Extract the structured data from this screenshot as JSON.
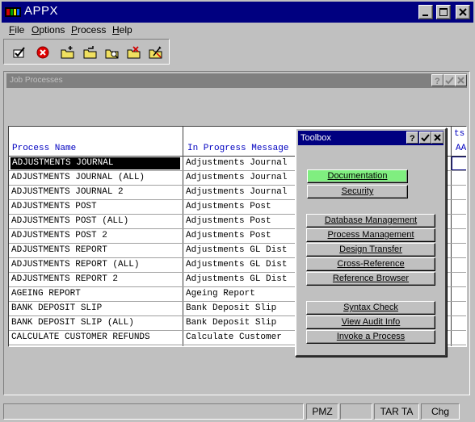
{
  "window": {
    "title": "APPX"
  },
  "menu": [
    {
      "pre": "",
      "u": "F",
      "post": "ile"
    },
    {
      "pre": "",
      "u": "O",
      "post": "ptions"
    },
    {
      "pre": "",
      "u": "P",
      "post": "rocess"
    },
    {
      "pre": "",
      "u": "H",
      "post": "elp"
    }
  ],
  "toolbar": {
    "buttons": [
      "ok-icon",
      "cancel-icon",
      "new-folder-icon",
      "open-folder-icon",
      "find-folder-icon",
      "delete-folder-icon",
      "edit-folder-icon"
    ]
  },
  "child_window": {
    "title": "Job Processes",
    "columns": {
      "name": "Process Name",
      "message": "In Progress Message",
      "partial_top": "ts-",
      "partial_bottom": "AA"
    },
    "rows": [
      {
        "name": "ADJUSTMENTS JOURNAL",
        "message": "Adjustments Journal"
      },
      {
        "name": "ADJUSTMENTS JOURNAL (ALL)",
        "message": "Adjustments Journal"
      },
      {
        "name": "ADJUSTMENTS JOURNAL 2",
        "message": "Adjustments Journal"
      },
      {
        "name": "ADJUSTMENTS POST",
        "message": "Adjustments Post"
      },
      {
        "name": "ADJUSTMENTS POST (ALL)",
        "message": "Adjustments Post"
      },
      {
        "name": "ADJUSTMENTS POST 2",
        "message": "Adjustments Post"
      },
      {
        "name": "ADJUSTMENTS REPORT",
        "message": "Adjustments GL Dist"
      },
      {
        "name": "ADJUSTMENTS REPORT (ALL)",
        "message": "Adjustments GL Dist"
      },
      {
        "name": "ADJUSTMENTS REPORT 2",
        "message": "Adjustments GL Dist"
      },
      {
        "name": "AGEING REPORT",
        "message": "Ageing Report"
      },
      {
        "name": "BANK DEPOSIT SLIP",
        "message": "Bank Deposit Slip"
      },
      {
        "name": "BANK DEPOSIT SLIP (ALL)",
        "message": "Bank Deposit Slip"
      },
      {
        "name": "CALCULATE CUSTOMER REFUNDS",
        "message": "Calculate Customer"
      }
    ]
  },
  "toolbox": {
    "title": "Toolbox",
    "buttons": {
      "documentation": "Documentation",
      "security": "Security",
      "database_management": "Database Management",
      "process_management": "Process Management",
      "design_transfer": "Design Transfer",
      "cross_reference": "Cross-Reference",
      "reference_browser": "Reference Browser",
      "syntax_check": "Syntax Check",
      "view_audit_info": "View Audit Info",
      "invoke_process": "Invoke a Process"
    },
    "active_color": "#80ee80"
  },
  "status": {
    "s1": "PMZ",
    "s2": "TAR TA",
    "s3": "Chg"
  },
  "colors": {
    "title_active": "#000080",
    "title_inactive": "#808080",
    "column_header": "#0000c0"
  }
}
